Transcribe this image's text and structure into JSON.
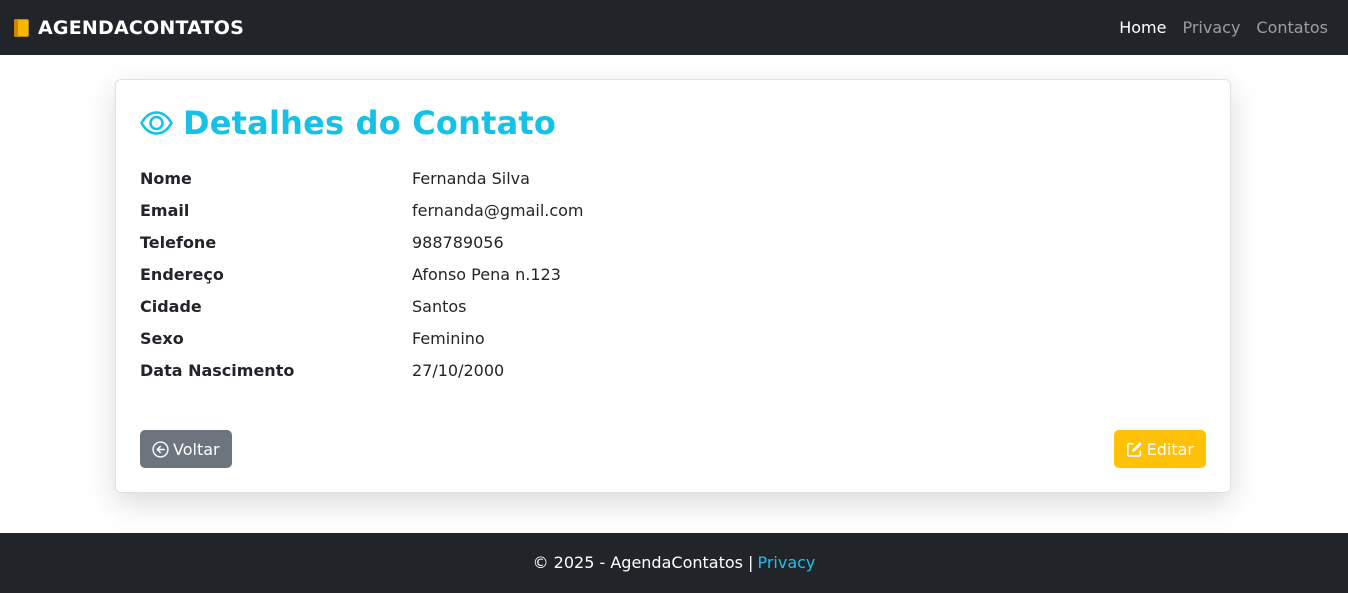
{
  "navbar": {
    "brand": "AGENDACONTATOS",
    "brand_icon": "notebook-icon",
    "links": [
      {
        "label": "Home",
        "active": true
      },
      {
        "label": "Privacy",
        "active": false
      },
      {
        "label": "Contatos",
        "active": false
      }
    ]
  },
  "card": {
    "title": "Detalhes do Contato",
    "title_icon": "eye-icon",
    "fields": [
      {
        "label": "Nome",
        "value": "Fernanda Silva"
      },
      {
        "label": "Email",
        "value": "fernanda@gmail.com"
      },
      {
        "label": "Telefone",
        "value": "988789056"
      },
      {
        "label": "Endereço",
        "value": "Afonso Pena n.123"
      },
      {
        "label": "Cidade",
        "value": "Santos"
      },
      {
        "label": "Sexo",
        "value": "Feminino"
      },
      {
        "label": "Data Nascimento",
        "value": "27/10/2000"
      }
    ],
    "back_label": "Voltar",
    "back_icon": "arrow-left-circle-icon",
    "edit_label": "Editar",
    "edit_icon": "pencil-square-icon"
  },
  "footer": {
    "text": "© 2025 - AgendaContatos |",
    "link": "Privacy"
  },
  "colors": {
    "navbar_bg": "#212529",
    "accent": "#13c2e6",
    "back_button": "#6c757d",
    "edit_button": "#ffc107"
  }
}
